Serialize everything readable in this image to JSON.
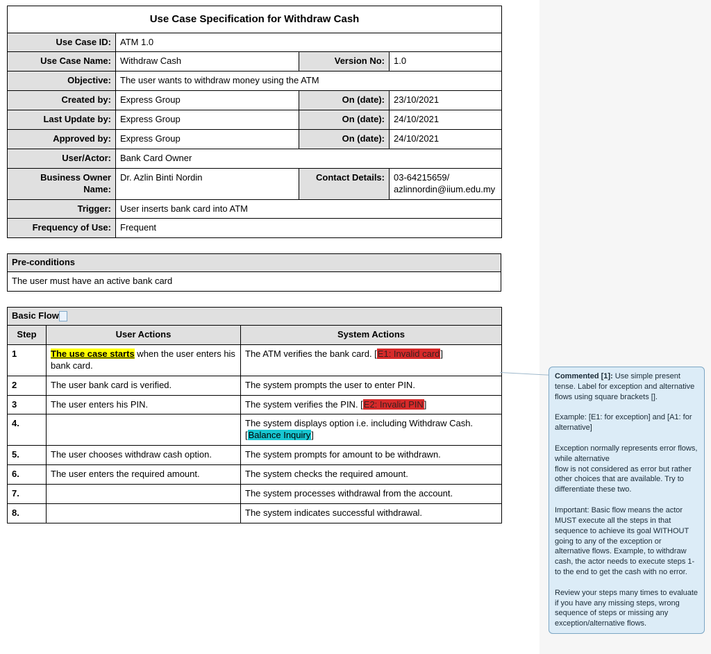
{
  "title": "Use Case Specification for Withdraw Cash",
  "labels": {
    "use_case_id": "Use Case ID:",
    "use_case_name": "Use Case Name:",
    "version_no": "Version No:",
    "objective": "Objective:",
    "created_by": "Created by:",
    "on_date": "On (date):",
    "last_update_by": "Last Update by:",
    "approved_by": "Approved by:",
    "user_actor": "User/Actor:",
    "business_owner": "Business Owner Name:",
    "contact_details": "Contact Details:",
    "trigger": "Trigger:",
    "frequency": "Frequency of Use:",
    "preconditions": "Pre-conditions",
    "basic_flow": "Basic Flow",
    "step": "Step",
    "user_actions": "User Actions",
    "system_actions": "System Actions"
  },
  "meta": {
    "use_case_id": "ATM 1.0",
    "use_case_name": "Withdraw Cash",
    "version_no": "1.0",
    "objective": "The user wants to withdraw money using the ATM",
    "created_by": "Express Group",
    "created_on": "23/10/2021",
    "last_update_by": "Express Group",
    "last_update_on": "24/10/2021",
    "approved_by": "Express Group",
    "approved_on": "24/10/2021",
    "user_actor": "Bank Card Owner",
    "business_owner": "Dr. Azlin Binti Nordin",
    "contact_details": "03-64215659/ azlinnordin@iium.edu.my",
    "trigger": "User inserts bank card into ATM",
    "frequency": "Frequent"
  },
  "preconditions": "The user must have an active bank card",
  "steps": [
    {
      "n": "1",
      "u_pre": "",
      "u_hi": "The use case starts",
      "u_post": " when the user enters his bank card.",
      "s_pre": "The ATM verifies the bank card. [",
      "s_tag": "E1: Invalid card",
      "s_post": "]",
      "tag_class": "hl-red"
    },
    {
      "n": "2",
      "u_pre": "The user bank card is verified.",
      "u_hi": "",
      "u_post": "",
      "s_pre": "The system prompts the user to enter PIN.",
      "s_tag": "",
      "s_post": "",
      "tag_class": ""
    },
    {
      "n": "3",
      "u_pre": "The user enters his PIN.",
      "u_hi": "",
      "u_post": "",
      "s_pre": "The system verifies the PIN. [",
      "s_tag": "E2: Invalid PIN",
      "s_post": "]",
      "tag_class": "hl-red"
    },
    {
      "n": "4.",
      "u_pre": "",
      "u_hi": "",
      "u_post": "",
      "s_pre": "The system displays option i.e. including Withdraw Cash. [",
      "s_tag": "Balance Inquiry",
      "s_post": "]",
      "tag_class": "hl-cyan"
    },
    {
      "n": "5.",
      "u_pre": "The user chooses withdraw cash option.",
      "u_hi": "",
      "u_post": "",
      "s_pre": "The system prompts for amount to be withdrawn.",
      "s_tag": "",
      "s_post": "",
      "tag_class": ""
    },
    {
      "n": "6.",
      "u_pre": "The user enters the required amount.",
      "u_hi": "",
      "u_post": "",
      "s_pre": "The system checks the required amount.",
      "s_tag": "",
      "s_post": "",
      "tag_class": ""
    },
    {
      "n": "7.",
      "u_pre": "",
      "u_hi": "",
      "u_post": "",
      "s_pre": "The system processes withdrawal from the account.",
      "s_tag": "",
      "s_post": "",
      "tag_class": ""
    },
    {
      "n": "8.",
      "u_pre": "",
      "u_hi": "",
      "u_post": "",
      "s_pre": "The system indicates successful withdrawal.",
      "s_tag": "",
      "s_post": "",
      "tag_class": ""
    }
  ],
  "comment": {
    "head": "Commented [1]:",
    "p1": " Use simple present tense. Label for exception and alternative flows using square brackets [].",
    "p2": "Example: [E1: for exception] and [A1: for alternative]",
    "p3": "Exception normally represents error flows, while alternative",
    "p4": "flow is not considered as error but rather other choices that are available. Try to differentiate these two.",
    "p5": "Important: Basic flow means the actor MUST execute all the steps in that sequence to achieve its goal WITHOUT going to any of the exception or alternative flows. Example, to withdraw cash, the actor needs to execute steps 1-to the end to get the cash with no error.",
    "p6": "Review your steps many times to evaluate if you have any missing steps, wrong sequence of steps or missing any exception/alternative flows."
  }
}
